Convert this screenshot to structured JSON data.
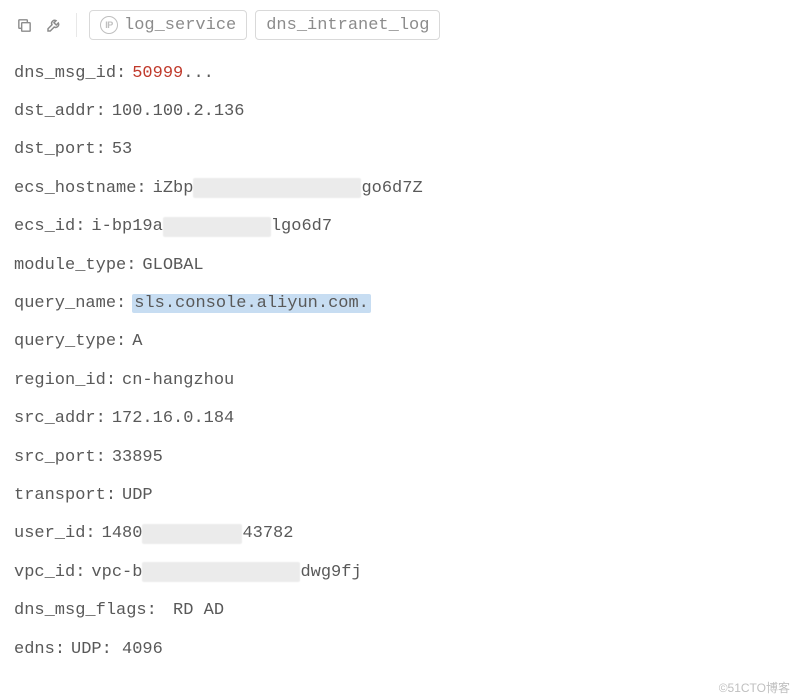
{
  "toolbar": {
    "tags": [
      {
        "label": "log_service",
        "has_ip_badge": true
      },
      {
        "label": "dns_intranet_log",
        "has_ip_badge": false
      }
    ]
  },
  "fields": [
    {
      "key": "dns_msg_id",
      "value": "50999",
      "suffix": "...",
      "style": "red"
    },
    {
      "key": "dst_addr",
      "value": "100.100.2.136"
    },
    {
      "key": "dst_port",
      "value": "53"
    },
    {
      "key": "ecs_hostname",
      "value_pre": "iZbp",
      "redact_w": 168,
      "value_post": "go6d7Z"
    },
    {
      "key": "ecs_id",
      "value_pre": "i-bp19a",
      "redact_w": 108,
      "value_post": "lgo6d7"
    },
    {
      "key": "module_type",
      "value": "GLOBAL"
    },
    {
      "key": "query_name",
      "value": "sls.console.aliyun.com.",
      "style": "highlight"
    },
    {
      "key": "query_type",
      "value": "A"
    },
    {
      "key": "region_id",
      "value": "cn-hangzhou"
    },
    {
      "key": "src_addr",
      "value": "172.16.0.184"
    },
    {
      "key": "src_port",
      "value": "33895"
    },
    {
      "key": "transport",
      "value": "UDP"
    },
    {
      "key": "user_id",
      "value_pre": "1480",
      "redact_w": 100,
      "value_post": "43782"
    },
    {
      "key": "vpc_id",
      "value_pre": "vpc-b",
      "redact_w": 158,
      "value_post": "dwg9fj"
    },
    {
      "key": "dns_msg_flags",
      "value": " RD AD"
    },
    {
      "key": "edns",
      "value": "UDP: 4096"
    }
  ],
  "watermark": "©51CTO博客"
}
